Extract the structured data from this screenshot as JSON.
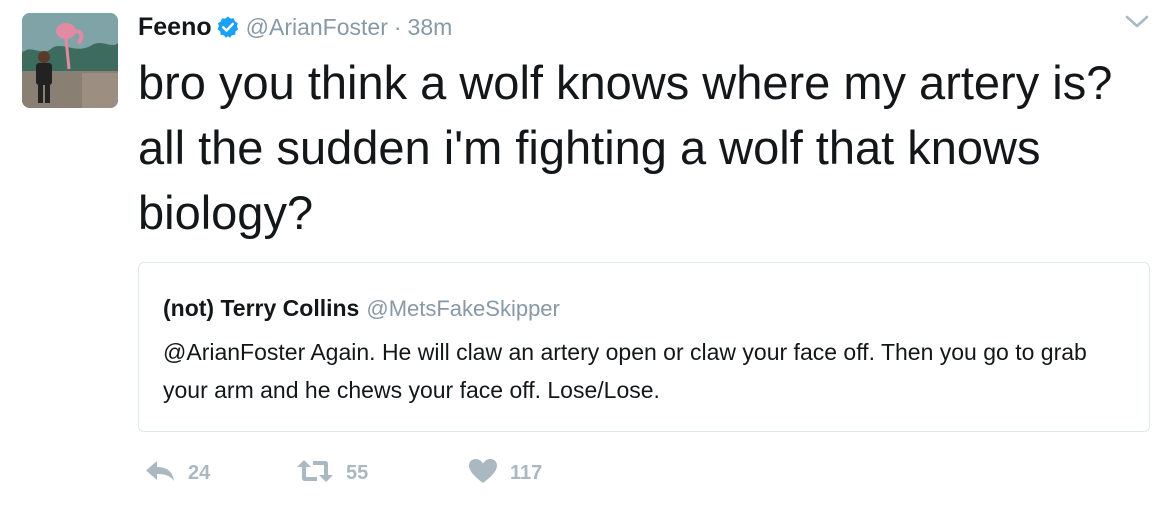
{
  "author": {
    "display_name": "Feeno",
    "handle": "@ArianFoster",
    "separator": "·",
    "time": "38m"
  },
  "tweet": {
    "text": "bro you think a wolf knows where my artery is? all the sudden i'm fighting a wolf that knows biology?"
  },
  "quote": {
    "display_name": "(not) Terry Collins",
    "handle": "@MetsFakeSkipper",
    "text": "@ArianFoster Again. He will claw an artery open or claw your face off. Then you go to grab your arm and he chews your face off. Lose/Lose."
  },
  "actions": {
    "reply": {
      "icon": "reply-icon",
      "count": "24"
    },
    "retweet": {
      "icon": "retweet-icon",
      "count": "55"
    },
    "like": {
      "icon": "heart-icon",
      "count": "117"
    }
  },
  "icons": {
    "verified": "verified-badge-icon",
    "more": "chevron-down-icon"
  },
  "colors": {
    "text": "#14171a",
    "secondary": "#8899a6",
    "action": "#aab8c2",
    "verified": "#1da1f2",
    "border": "#e1e8ed"
  }
}
